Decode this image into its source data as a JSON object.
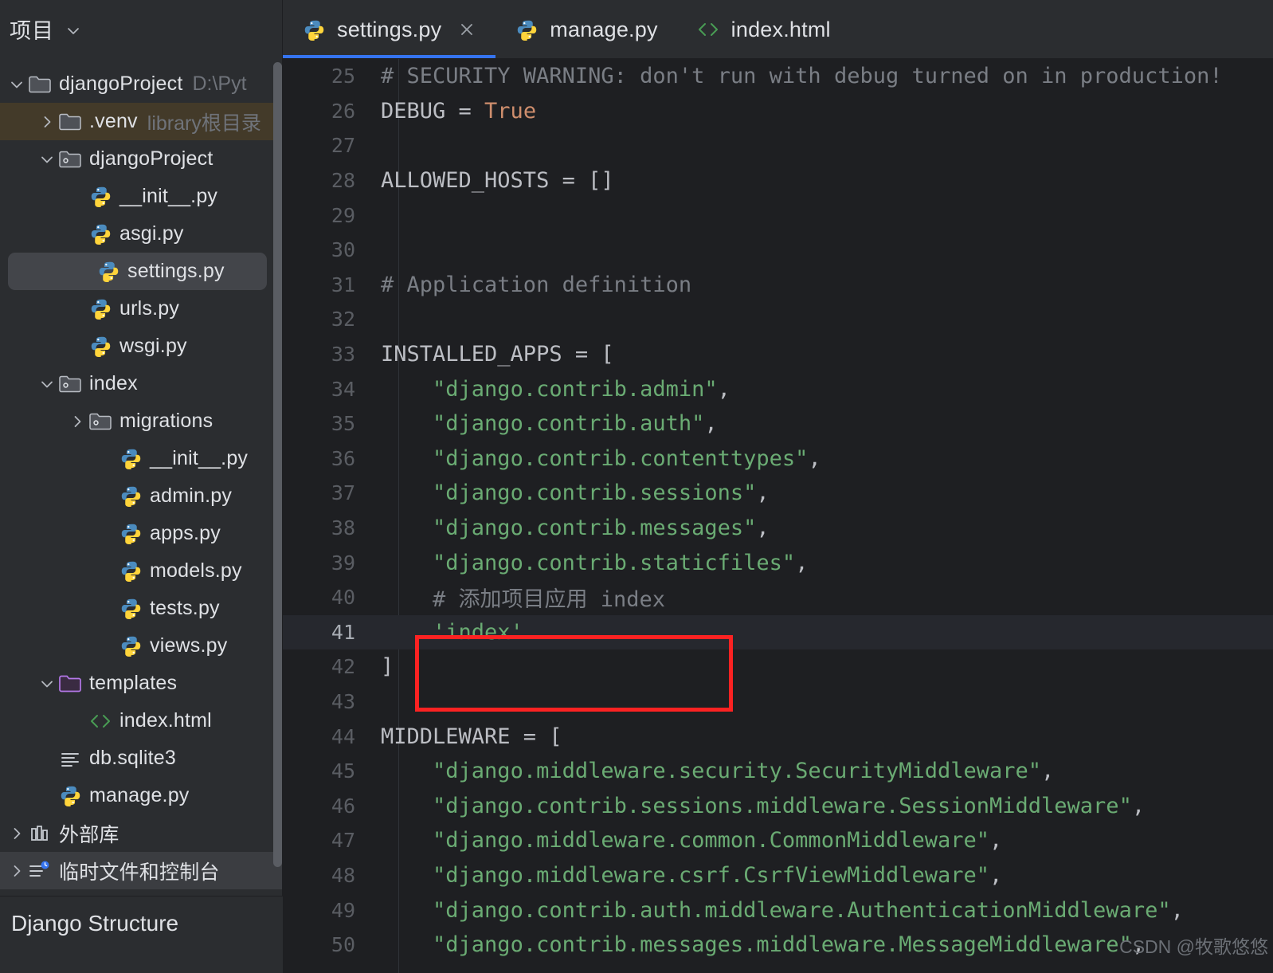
{
  "sidebar": {
    "header": {
      "title": "项目",
      "chevron_icon": "chevron-down-icon"
    },
    "tree": [
      {
        "id": "djangoProject-root",
        "label": "djangoProject",
        "sub": "D:\\Pyt",
        "indent": 0,
        "arrow": "chevron-down-icon",
        "icon": "folder-icon",
        "state": "none"
      },
      {
        "id": "venv",
        "label": ".venv",
        "sub": "library根目录",
        "indent": 1,
        "arrow": "chevron-right-icon",
        "icon": "folder-icon",
        "state": "highlight-brown"
      },
      {
        "id": "djangoProject-pkg",
        "label": "djangoProject",
        "sub": "",
        "indent": 1,
        "arrow": "chevron-down-icon",
        "icon": "module-folder-icon",
        "state": "none"
      },
      {
        "id": "init-py-proj",
        "label": "__init__.py",
        "sub": "",
        "indent": 2,
        "arrow": "",
        "icon": "python-file-icon",
        "state": "none"
      },
      {
        "id": "asgi-py",
        "label": "asgi.py",
        "sub": "",
        "indent": 2,
        "arrow": "",
        "icon": "python-file-icon",
        "state": "none"
      },
      {
        "id": "settings-py",
        "label": "settings.py",
        "sub": "",
        "indent": 2,
        "arrow": "",
        "icon": "python-file-icon",
        "state": "selected"
      },
      {
        "id": "urls-py",
        "label": "urls.py",
        "sub": "",
        "indent": 2,
        "arrow": "",
        "icon": "python-file-icon",
        "state": "none"
      },
      {
        "id": "wsgi-py",
        "label": "wsgi.py",
        "sub": "",
        "indent": 2,
        "arrow": "",
        "icon": "python-file-icon",
        "state": "none"
      },
      {
        "id": "index-pkg",
        "label": "index",
        "sub": "",
        "indent": 1,
        "arrow": "chevron-down-icon",
        "icon": "module-folder-icon",
        "state": "none"
      },
      {
        "id": "migrations",
        "label": "migrations",
        "sub": "",
        "indent": 2,
        "arrow": "chevron-right-icon",
        "icon": "module-folder-icon",
        "state": "none"
      },
      {
        "id": "init-py-index",
        "label": "__init__.py",
        "sub": "",
        "indent": 3,
        "arrow": "",
        "icon": "python-file-icon",
        "state": "none"
      },
      {
        "id": "admin-py",
        "label": "admin.py",
        "sub": "",
        "indent": 3,
        "arrow": "",
        "icon": "python-file-icon",
        "state": "none"
      },
      {
        "id": "apps-py",
        "label": "apps.py",
        "sub": "",
        "indent": 3,
        "arrow": "",
        "icon": "python-file-icon",
        "state": "none"
      },
      {
        "id": "models-py",
        "label": "models.py",
        "sub": "",
        "indent": 3,
        "arrow": "",
        "icon": "python-file-icon",
        "state": "none"
      },
      {
        "id": "tests-py",
        "label": "tests.py",
        "sub": "",
        "indent": 3,
        "arrow": "",
        "icon": "python-file-icon",
        "state": "none"
      },
      {
        "id": "views-py",
        "label": "views.py",
        "sub": "",
        "indent": 3,
        "arrow": "",
        "icon": "python-file-icon",
        "state": "none"
      },
      {
        "id": "templates",
        "label": "templates",
        "sub": "",
        "indent": 1,
        "arrow": "chevron-down-icon",
        "icon": "templates-folder-icon",
        "state": "none"
      },
      {
        "id": "index-html",
        "label": "index.html",
        "sub": "",
        "indent": 2,
        "arrow": "",
        "icon": "html-file-icon",
        "state": "none"
      },
      {
        "id": "db-sqlite3",
        "label": "db.sqlite3",
        "sub": "",
        "indent": 1,
        "arrow": "",
        "icon": "file-lines-icon",
        "state": "none"
      },
      {
        "id": "manage-py",
        "label": "manage.py",
        "sub": "",
        "indent": 1,
        "arrow": "",
        "icon": "python-file-icon",
        "state": "none"
      },
      {
        "id": "external-libraries",
        "label": "外部库",
        "sub": "",
        "indent": 0,
        "arrow": "chevron-right-icon",
        "icon": "library-icon",
        "state": "none"
      },
      {
        "id": "scratches-consoles",
        "label": "临时文件和控制台",
        "sub": "",
        "indent": 0,
        "arrow": "chevron-right-icon",
        "icon": "scratches-icon",
        "state": "highlight-grey"
      }
    ],
    "bottom_bar": {
      "label": "Django Structure"
    }
  },
  "tabs": [
    {
      "id": "tab-settings-py",
      "label": "settings.py",
      "icon": "python-file-icon",
      "active": true,
      "closable": true,
      "close_icon": "close-icon"
    },
    {
      "id": "tab-manage-py",
      "label": "manage.py",
      "icon": "python-file-icon",
      "active": false,
      "closable": false
    },
    {
      "id": "tab-index-html",
      "label": "index.html",
      "icon": "html-file-icon",
      "active": false,
      "closable": false
    }
  ],
  "editor": {
    "current_line": 41,
    "lines": [
      {
        "n": 25,
        "tokens": [
          {
            "t": "# SECURITY WARNING: don't run with debug turned on in production!",
            "c": "comment"
          }
        ]
      },
      {
        "n": 26,
        "tokens": [
          {
            "t": "DEBUG = ",
            "c": "plain"
          },
          {
            "t": "True",
            "c": "kw"
          }
        ]
      },
      {
        "n": 27,
        "tokens": []
      },
      {
        "n": 28,
        "tokens": [
          {
            "t": "ALLOWED_HOSTS = []",
            "c": "plain"
          }
        ]
      },
      {
        "n": 29,
        "tokens": []
      },
      {
        "n": 30,
        "tokens": []
      },
      {
        "n": 31,
        "tokens": [
          {
            "t": "# Application definition",
            "c": "comment"
          }
        ]
      },
      {
        "n": 32,
        "tokens": []
      },
      {
        "n": 33,
        "tokens": [
          {
            "t": "INSTALLED_APPS = [",
            "c": "plain"
          }
        ]
      },
      {
        "n": 34,
        "tokens": [
          {
            "t": "    ",
            "c": "plain"
          },
          {
            "t": "\"django.contrib.admin\"",
            "c": "str"
          },
          {
            "t": ",",
            "c": "plain"
          }
        ]
      },
      {
        "n": 35,
        "tokens": [
          {
            "t": "    ",
            "c": "plain"
          },
          {
            "t": "\"django.contrib.auth\"",
            "c": "str"
          },
          {
            "t": ",",
            "c": "plain"
          }
        ]
      },
      {
        "n": 36,
        "tokens": [
          {
            "t": "    ",
            "c": "plain"
          },
          {
            "t": "\"django.contrib.contenttypes\"",
            "c": "str"
          },
          {
            "t": ",",
            "c": "plain"
          }
        ]
      },
      {
        "n": 37,
        "tokens": [
          {
            "t": "    ",
            "c": "plain"
          },
          {
            "t": "\"django.contrib.sessions\"",
            "c": "str"
          },
          {
            "t": ",",
            "c": "plain"
          }
        ]
      },
      {
        "n": 38,
        "tokens": [
          {
            "t": "    ",
            "c": "plain"
          },
          {
            "t": "\"django.contrib.messages\"",
            "c": "str"
          },
          {
            "t": ",",
            "c": "plain"
          }
        ]
      },
      {
        "n": 39,
        "tokens": [
          {
            "t": "    ",
            "c": "plain"
          },
          {
            "t": "\"django.contrib.staticfiles\"",
            "c": "str"
          },
          {
            "t": ",",
            "c": "plain"
          }
        ]
      },
      {
        "n": 40,
        "tokens": [
          {
            "t": "    # 添加项目应用 index",
            "c": "comment"
          }
        ]
      },
      {
        "n": 41,
        "tokens": [
          {
            "t": "    ",
            "c": "plain"
          },
          {
            "t": "'index'",
            "c": "str"
          }
        ]
      },
      {
        "n": 42,
        "tokens": [
          {
            "t": "]",
            "c": "plain"
          }
        ]
      },
      {
        "n": 43,
        "tokens": []
      },
      {
        "n": 44,
        "tokens": [
          {
            "t": "MIDDLEWARE = [",
            "c": "plain"
          }
        ]
      },
      {
        "n": 45,
        "tokens": [
          {
            "t": "    ",
            "c": "plain"
          },
          {
            "t": "\"django.middleware.security.SecurityMiddleware\"",
            "c": "str"
          },
          {
            "t": ",",
            "c": "plain"
          }
        ]
      },
      {
        "n": 46,
        "tokens": [
          {
            "t": "    ",
            "c": "plain"
          },
          {
            "t": "\"django.contrib.sessions.middleware.SessionMiddleware\"",
            "c": "str"
          },
          {
            "t": ",",
            "c": "plain"
          }
        ]
      },
      {
        "n": 47,
        "tokens": [
          {
            "t": "    ",
            "c": "plain"
          },
          {
            "t": "\"django.middleware.common.CommonMiddleware\"",
            "c": "str"
          },
          {
            "t": ",",
            "c": "plain"
          }
        ]
      },
      {
        "n": 48,
        "tokens": [
          {
            "t": "    ",
            "c": "plain"
          },
          {
            "t": "\"django.middleware.csrf.CsrfViewMiddleware\"",
            "c": "str"
          },
          {
            "t": ",",
            "c": "plain"
          }
        ]
      },
      {
        "n": 49,
        "tokens": [
          {
            "t": "    ",
            "c": "plain"
          },
          {
            "t": "\"django.contrib.auth.middleware.AuthenticationMiddleware\"",
            "c": "str"
          },
          {
            "t": ",",
            "c": "plain"
          }
        ]
      },
      {
        "n": 50,
        "tokens": [
          {
            "t": "    ",
            "c": "plain"
          },
          {
            "t": "\"django.contrib.messages.middleware.MessageMiddleware\"",
            "c": "str"
          },
          {
            "t": ",",
            "c": "plain"
          }
        ]
      }
    ],
    "annotation": {
      "type": "red-rectangle",
      "color": "#fb2222",
      "covers_lines": [
        40,
        41
      ]
    }
  },
  "watermark": {
    "text": "CSDN @牧歌悠悠"
  },
  "colors": {
    "accent": "#3574f0",
    "editor_bg": "#1e1f22",
    "panel_bg": "#2b2d30",
    "string_green": "#6aab73",
    "keyword_orange": "#cf8e6d",
    "comment_grey": "#7a7e85",
    "annotation_red": "#fb2222",
    "selection_brown": "#433a29"
  }
}
